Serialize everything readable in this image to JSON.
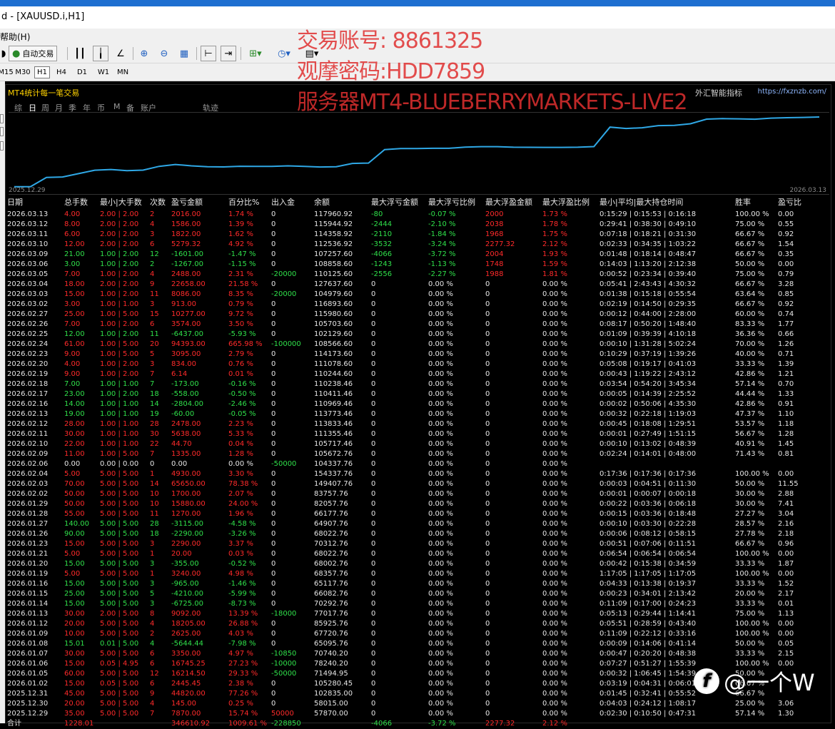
{
  "window": {
    "title": "d - [XAUUSD.i,H1]"
  },
  "menu": {
    "help": "帮助(H)"
  },
  "toolbar": {
    "autotrade": "自动交易"
  },
  "timeframes": [
    "M15",
    "M30",
    "H1",
    "H4",
    "D1",
    "W1",
    "MN"
  ],
  "timeframe_active": "H1",
  "panel": {
    "title": "MT4统计每一笔交易",
    "brand": "外汇智能指标",
    "url": "https://fxznzb.com/",
    "tabs": [
      "综",
      "日",
      "周",
      "月",
      "季",
      "年",
      "币",
      "M",
      "备",
      "账户",
      "轨迹"
    ],
    "tab_active": "日"
  },
  "equity": {
    "from": "2025.12.29",
    "to": "2026.03.13",
    "color": "#2fa8e6"
  },
  "table": {
    "headers": [
      "日期",
      "总手数",
      "最小|大手数",
      "次数",
      "盈亏金额",
      "百分比%",
      "出入金",
      "余额",
      "最大浮亏金额",
      "最大浮亏比例",
      "最大浮盈金额",
      "最大浮盈比例",
      "最小|平均|最大持仓时间",
      "胜率",
      "盈亏比"
    ],
    "rows": [
      [
        "2026.03.13",
        "4.00",
        "2.00 | 2.00",
        "2",
        "2016.00",
        "1.74 %",
        "0",
        "117960.92",
        "-80",
        "-0.07 %",
        "2000",
        "1.73 %",
        "0:15:29 | 0:15:53 | 0:16:18",
        "100.00 %",
        "0.00",
        "r"
      ],
      [
        "2026.03.12",
        "8.00",
        "2.00 | 2.00",
        "4",
        "1586.00",
        "1.39 %",
        "0",
        "115944.92",
        "-2444",
        "-2.10 %",
        "2038",
        "1.78 %",
        "0:29:41 | 0:38:30 | 0:49:10",
        "75.00 %",
        "0.55",
        "r"
      ],
      [
        "2026.03.11",
        "6.00",
        "2.00 | 2.00",
        "3",
        "1822.00",
        "1.62 %",
        "0",
        "114358.92",
        "-2110",
        "-1.84 %",
        "1968",
        "1.75 %",
        "0:07:18 | 0:18:21 | 0:31:30",
        "66.67 %",
        "0.92",
        "r"
      ],
      [
        "2026.03.10",
        "12.00",
        "2.00 | 2.00",
        "6",
        "5279.32",
        "4.92 %",
        "0",
        "112536.92",
        "-3532",
        "-3.24 %",
        "2277.32",
        "2.12 %",
        "0:02:33 | 0:34:35 | 1:03:22",
        "66.67 %",
        "1.54",
        "r"
      ],
      [
        "2026.03.09",
        "21.00",
        "1.00 | 2.00",
        "12",
        "-1601.00",
        "-1.47 %",
        "0",
        "107257.60",
        "-4066",
        "-3.72 %",
        "2004",
        "1.93 %",
        "0:01:48 | 0:18:14 | 0:48:47",
        "66.67 %",
        "0.35",
        "g"
      ],
      [
        "2026.03.06",
        "3.00",
        "1.00 | 2.00",
        "2",
        "-1267.00",
        "-1.15 %",
        "0",
        "108858.60",
        "-1243",
        "-1.13 %",
        "1748",
        "1.59 %",
        "0:14:03 | 1:13:20 | 2:12:38",
        "50.00 %",
        "0.00",
        "g"
      ],
      [
        "2026.03.05",
        "7.00",
        "1.00 | 2.00",
        "4",
        "2488.00",
        "2.31 %",
        "-20000",
        "110125.60",
        "-2556",
        "-2.27 %",
        "1988",
        "1.81 %",
        "0:00:52 | 0:23:34 | 0:39:40",
        "75.00 %",
        "0.79",
        "r"
      ],
      [
        "2026.03.04",
        "18.00",
        "2.00 | 2.00",
        "9",
        "22658.00",
        "21.58 %",
        "0",
        "127637.60",
        "0",
        "0.00 %",
        "0",
        "0.00 %",
        "0:05:41 | 2:43:43 | 4:30:32",
        "66.67 %",
        "3.28",
        "r"
      ],
      [
        "2026.03.03",
        "15.00",
        "1.00 | 2.00",
        "11",
        "8086.00",
        "8.35 %",
        "-20000",
        "104979.60",
        "0",
        "0.00 %",
        "0",
        "0.00 %",
        "0:01:38 | 0:15:18 | 0:55:54",
        "63.64 %",
        "0.85",
        "r"
      ],
      [
        "2026.03.02",
        "3.00",
        "1.00 | 1.00",
        "3",
        "913.00",
        "0.79 %",
        "0",
        "116893.60",
        "0",
        "0.00 %",
        "0",
        "0.00 %",
        "0:02:19 | 0:14:50 | 0:29:35",
        "66.67 %",
        "0.92",
        "r"
      ],
      [
        "2026.02.27",
        "25.00",
        "1.00 | 5.00",
        "15",
        "10277.00",
        "9.72 %",
        "0",
        "115980.60",
        "0",
        "0.00 %",
        "0",
        "0.00 %",
        "0:00:12 | 0:44:00 | 2:28:00",
        "60.00 %",
        "0.74",
        "r"
      ],
      [
        "2026.02.26",
        "7.00",
        "1.00 | 2.00",
        "6",
        "3574.00",
        "3.50 %",
        "0",
        "105703.60",
        "0",
        "0.00 %",
        "0",
        "0.00 %",
        "0:08:17 | 0:50:20 | 1:48:40",
        "83.33 %",
        "1.77",
        "r"
      ],
      [
        "2026.02.25",
        "12.00",
        "1.00 | 2.00",
        "11",
        "-6437.00",
        "-5.93 %",
        "0",
        "102129.60",
        "0",
        "0.00 %",
        "0",
        "0.00 %",
        "0:01:09 | 0:39:39 | 4:10:18",
        "36.36 %",
        "0.66",
        "g"
      ],
      [
        "2026.02.24",
        "61.00",
        "1.00 | 5.00",
        "20",
        "94393.00",
        "665.98 %",
        "-100000",
        "108566.60",
        "0",
        "0.00 %",
        "0",
        "0.00 %",
        "0:00:10 | 1:31:28 | 5:02:24",
        "70.00 %",
        "1.26",
        "r"
      ],
      [
        "2026.02.23",
        "9.00",
        "1.00 | 5.00",
        "5",
        "3095.00",
        "2.79 %",
        "0",
        "114173.60",
        "0",
        "0.00 %",
        "0",
        "0.00 %",
        "0:10:29 | 0:37:19 | 1:39:26",
        "40.00 %",
        "0.71",
        "r"
      ],
      [
        "2026.02.20",
        "4.00",
        "1.00 | 2.00",
        "3",
        "834.00",
        "0.76 %",
        "0",
        "111078.60",
        "0",
        "0.00 %",
        "0",
        "0.00 %",
        "0:05:08 | 0:19:17 | 0:41:03",
        "33.33 %",
        "1.39",
        "r"
      ],
      [
        "2026.02.19",
        "9.00",
        "1.00 | 2.00",
        "7",
        "6.14",
        "0.01 %",
        "0",
        "110244.60",
        "0",
        "0.00 %",
        "0",
        "0.00 %",
        "0:00:43 | 1:19:22 | 2:43:12",
        "42.86 %",
        "1.21",
        "r"
      ],
      [
        "2026.02.18",
        "7.00",
        "1.00 | 1.00",
        "7",
        "-173.00",
        "-0.16 %",
        "0",
        "110238.46",
        "0",
        "0.00 %",
        "0",
        "0.00 %",
        "0:03:54 | 0:54:20 | 3:45:34",
        "57.14 %",
        "0.70",
        "g"
      ],
      [
        "2026.02.17",
        "23.00",
        "1.00 | 2.00",
        "18",
        "-558.00",
        "-0.50 %",
        "0",
        "110411.46",
        "0",
        "0.00 %",
        "0",
        "0.00 %",
        "0:00:05 | 0:14:39 | 2:25:52",
        "44.44 %",
        "1.33",
        "g"
      ],
      [
        "2026.02.16",
        "14.00",
        "1.00 | 1.00",
        "14",
        "-2804.00",
        "-2.46 %",
        "0",
        "110969.46",
        "0",
        "0.00 %",
        "0",
        "0.00 %",
        "0:00:02 | 0:50:06 | 4:35:30",
        "42.86 %",
        "0.91",
        "g"
      ],
      [
        "2026.02.13",
        "19.00",
        "1.00 | 1.00",
        "19",
        "-60.00",
        "-0.05 %",
        "0",
        "113773.46",
        "0",
        "0.00 %",
        "0",
        "0.00 %",
        "0:00:32 | 0:22:18 | 1:19:03",
        "47.37 %",
        "1.10",
        "g"
      ],
      [
        "2026.02.12",
        "28.00",
        "1.00 | 1.00",
        "28",
        "2478.00",
        "2.23 %",
        "0",
        "113833.46",
        "0",
        "0.00 %",
        "0",
        "0.00 %",
        "0:00:45 | 0:18:08 | 1:29:51",
        "53.57 %",
        "1.18",
        "r"
      ],
      [
        "2026.02.11",
        "30.00",
        "1.00 | 1.00",
        "30",
        "5638.00",
        "5.33 %",
        "0",
        "111355.46",
        "0",
        "0.00 %",
        "0",
        "0.00 %",
        "0:00:01 | 0:27:49 | 1:51:15",
        "56.67 %",
        "1.28",
        "r"
      ],
      [
        "2026.02.10",
        "22.00",
        "1.00 | 1.00",
        "22",
        "44.70",
        "0.04 %",
        "0",
        "105717.46",
        "0",
        "0.00 %",
        "0",
        "0.00 %",
        "0:00:10 | 0:13:02 | 0:48:39",
        "40.91 %",
        "1.45",
        "r"
      ],
      [
        "2026.02.09",
        "11.00",
        "1.00 | 5.00",
        "7",
        "1335.00",
        "1.28 %",
        "0",
        "105672.76",
        "0",
        "0.00 %",
        "0",
        "0.00 %",
        "0:02:24 | 0:14:01 | 0:48:00",
        "71.43 %",
        "0.81",
        "r"
      ],
      [
        "2026.02.06",
        "0.00",
        "0.00 | 0.00",
        "0",
        "0.00",
        "0.00 %",
        "-50000",
        "104337.76",
        "0",
        "0.00 %",
        "0",
        "0.00 %",
        "",
        "",
        "",
        "w"
      ],
      [
        "2026.02.04",
        "5.00",
        "5.00 | 5.00",
        "1",
        "4930.00",
        "3.30 %",
        "0",
        "154337.76",
        "0",
        "0.00 %",
        "0",
        "0.00 %",
        "0:17:36 | 0:17:36 | 0:17:36",
        "100.00 %",
        "0.00",
        "r"
      ],
      [
        "2026.02.03",
        "70.00",
        "5.00 | 5.00",
        "14",
        "65650.00",
        "78.38 %",
        "0",
        "149407.76",
        "0",
        "0.00 %",
        "0",
        "0.00 %",
        "0:00:03 | 0:04:51 | 0:11:30",
        "50.00 %",
        "11.55",
        "r"
      ],
      [
        "2026.02.02",
        "50.00",
        "5.00 | 5.00",
        "10",
        "1700.00",
        "2.07 %",
        "0",
        "83757.76",
        "0",
        "0.00 %",
        "0",
        "0.00 %",
        "0:00:01 | 0:00:07 | 0:00:18",
        "30.00 %",
        "2.88",
        "r"
      ],
      [
        "2026.01.29",
        "50.00",
        "5.00 | 5.00",
        "10",
        "15880.00",
        "24.00 %",
        "0",
        "82057.76",
        "0",
        "0.00 %",
        "0",
        "0.00 %",
        "0:00:22 | 0:03:36 | 0:06:18",
        "30.00 %",
        "7.41",
        "r"
      ],
      [
        "2026.01.28",
        "55.00",
        "5.00 | 5.00",
        "11",
        "1270.00",
        "1.96 %",
        "0",
        "66177.76",
        "0",
        "0.00 %",
        "0",
        "0.00 %",
        "0:00:15 | 0:03:36 | 0:18:48",
        "27.27 %",
        "3.04",
        "r"
      ],
      [
        "2026.01.27",
        "140.00",
        "5.00 | 5.00",
        "28",
        "-3115.00",
        "-4.58 %",
        "0",
        "64907.76",
        "0",
        "0.00 %",
        "0",
        "0.00 %",
        "0:00:10 | 0:03:30 | 0:22:28",
        "28.57 %",
        "2.16",
        "g"
      ],
      [
        "2026.01.26",
        "90.00",
        "5.00 | 5.00",
        "18",
        "-2290.00",
        "-3.26 %",
        "0",
        "68022.76",
        "0",
        "0.00 %",
        "0",
        "0.00 %",
        "0:00:06 | 0:08:12 | 0:58:15",
        "27.78 %",
        "2.18",
        "g"
      ],
      [
        "2026.01.23",
        "15.00",
        "5.00 | 5.00",
        "3",
        "2290.00",
        "3.37 %",
        "0",
        "70312.76",
        "0",
        "0.00 %",
        "0",
        "0.00 %",
        "0:00:51 | 0:07:06 | 0:11:51",
        "66.67 %",
        "0.96",
        "r"
      ],
      [
        "2026.01.21",
        "5.00",
        "5.00 | 5.00",
        "1",
        "20.00",
        "0.03 %",
        "0",
        "68022.76",
        "0",
        "0.00 %",
        "0",
        "0.00 %",
        "0:06:54 | 0:06:54 | 0:06:54",
        "100.00 %",
        "0.00",
        "r"
      ],
      [
        "2026.01.20",
        "15.00",
        "5.00 | 5.00",
        "3",
        "-355.00",
        "-0.52 %",
        "0",
        "68002.76",
        "0",
        "0.00 %",
        "0",
        "0.00 %",
        "0:00:42 | 0:15:38 | 0:34:59",
        "33.33 %",
        "1.87",
        "g"
      ],
      [
        "2026.01.19",
        "5.00",
        "5.00 | 5.00",
        "1",
        "3240.00",
        "4.98 %",
        "0",
        "68357.76",
        "0",
        "0.00 %",
        "0",
        "0.00 %",
        "1:17:05 | 1:17:05 | 1:17:05",
        "100.00 %",
        "0.00",
        "r"
      ],
      [
        "2026.01.16",
        "15.00",
        "5.00 | 5.00",
        "3",
        "-965.00",
        "-1.46 %",
        "0",
        "65117.76",
        "0",
        "0.00 %",
        "0",
        "0.00 %",
        "0:04:33 | 0:13:38 | 0:19:37",
        "33.33 %",
        "1.52",
        "g"
      ],
      [
        "2026.01.15",
        "25.00",
        "5.00 | 5.00",
        "5",
        "-4210.00",
        "-5.99 %",
        "0",
        "66082.76",
        "0",
        "0.00 %",
        "0",
        "0.00 %",
        "0:00:23 | 0:34:01 | 2:13:42",
        "20.00 %",
        "2.17",
        "g"
      ],
      [
        "2026.01.14",
        "15.00",
        "5.00 | 5.00",
        "3",
        "-6725.00",
        "-8.73 %",
        "0",
        "70292.76",
        "0",
        "0.00 %",
        "0",
        "0.00 %",
        "0:11:09 | 0:17:00 | 0:24:23",
        "33.33 %",
        "0.01",
        "g"
      ],
      [
        "2026.01.13",
        "30.00",
        "2.00 | 5.00",
        "8",
        "9092.00",
        "13.39 %",
        "-18000",
        "77017.76",
        "0",
        "0.00 %",
        "0",
        "0.00 %",
        "0:05:13 | 0:29:44 | 1:14:41",
        "75.00 %",
        "1.13",
        "r"
      ],
      [
        "2026.01.12",
        "20.00",
        "5.00 | 5.00",
        "4",
        "18205.00",
        "26.88 %",
        "0",
        "85925.76",
        "0",
        "0.00 %",
        "0",
        "0.00 %",
        "0:05:51 | 0:28:59 | 0:43:40",
        "100.00 %",
        "0.00",
        "r"
      ],
      [
        "2026.01.09",
        "10.00",
        "5.00 | 5.00",
        "2",
        "2625.00",
        "4.03 %",
        "0",
        "67720.76",
        "0",
        "0.00 %",
        "0",
        "0.00 %",
        "0:11:09 | 0:22:12 | 0:33:16",
        "100.00 %",
        "0.00",
        "r"
      ],
      [
        "2026.01.08",
        "15.01",
        "0.01 | 5.00",
        "4",
        "-5644.44",
        "-7.98 %",
        "0",
        "65095.76",
        "0",
        "0.00 %",
        "0",
        "0.00 %",
        "0:00:09 | 0:14:06 | 0:41:14",
        "50.00 %",
        "0.05",
        "g"
      ],
      [
        "2026.01.07",
        "30.00",
        "5.00 | 5.00",
        "6",
        "3350.00",
        "4.97 %",
        "-10850",
        "70740.20",
        "0",
        "0.00 %",
        "0",
        "0.00 %",
        "0:00:47 | 0:20:20 | 0:48:38",
        "33.33 %",
        "2.15",
        "r"
      ],
      [
        "2026.01.06",
        "15.00",
        "0.05 | 4.95",
        "6",
        "16745.25",
        "27.23 %",
        "-10000",
        "78240.20",
        "0",
        "0.00 %",
        "0",
        "0.00 %",
        "0:07:27 | 0:51:27 | 1:55:39",
        "100.00 %",
        "0.00",
        "r"
      ],
      [
        "2026.01.05",
        "60.00",
        "5.00 | 5.00",
        "12",
        "16214.50",
        "29.33 %",
        "-50000",
        "71494.95",
        "0",
        "0.00 %",
        "0",
        "0.00 %",
        "0:00:32 | 1:06:45 | 1:54:39",
        "50.00 %",
        "",
        "r"
      ],
      [
        "2026.01.02",
        "15.00",
        "0.05 | 5.00",
        "6",
        "2445.45",
        "2.38 %",
        "0",
        "105280.45",
        "0",
        "0.00 %",
        "0",
        "0.00 %",
        "0:03:19 | 0:04:31 | 0:06:01",
        "66.67 %",
        "",
        "r"
      ],
      [
        "2025.12.31",
        "45.00",
        "5.00 | 5.00",
        "9",
        "44820.00",
        "77.26 %",
        "0",
        "102835.00",
        "0",
        "0.00 %",
        "0",
        "0.00 %",
        "0:01:45 | 0:32:41 | 0:55:52",
        "66.67 %",
        "",
        "r"
      ],
      [
        "2025.12.30",
        "20.00",
        "5.00 | 5.00",
        "4",
        "145.00",
        "0.25 %",
        "0",
        "58015.00",
        "0",
        "0.00 %",
        "0",
        "0.00 %",
        "0:04:03 | 0:24:12 | 1:08:17",
        "25.00 %",
        "3.06",
        "r"
      ],
      [
        "2025.12.29",
        "35.00",
        "5.00 | 5.00",
        "7",
        "7870.00",
        "15.74 %",
        "50000",
        "57870.00",
        "0",
        "0.00 %",
        "0",
        "0.00 %",
        "0:02:30 | 0:10:50 | 0:47:31",
        "57.14 %",
        "1.30",
        "r"
      ],
      [
        "合计",
        "1228.01",
        "",
        "",
        "346610.92",
        "1009.61 %",
        "-228850",
        "",
        "-4066",
        "-3.72 %",
        "2277.32",
        "2.12 %",
        "",
        "",
        "",
        "r"
      ]
    ]
  },
  "watermark": {
    "line1": "交易账号: 8861325",
    "line2": "观摩密码:HDD7859",
    "line3": "服务器MT4-BLUEBERRYMARKETS-LIVE2"
  },
  "badge": {
    "text": "@一个W"
  }
}
